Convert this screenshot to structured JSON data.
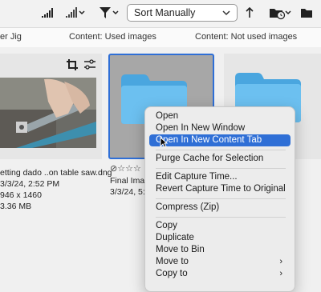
{
  "toolbar": {
    "sort_value": "Sort Manually"
  },
  "header": {
    "col1": "er Jig",
    "col2": "Content: Used images",
    "col3": "Content: Not used images"
  },
  "items": {
    "photo": {
      "filename": "etting dado ..on table saw.dng",
      "date": "3/3/24, 2:52 PM",
      "dimensions": "946 x 1460",
      "size": "3.36 MB"
    },
    "folder": {
      "name": "Final Image",
      "date": "3/3/24, 5:1"
    }
  },
  "context_menu": {
    "items": [
      {
        "label": "Open"
      },
      {
        "label": "Open In New Window"
      },
      {
        "label": "Open In New Content Tab"
      },
      {
        "label": "Purge Cache for Selection"
      },
      {
        "label": "Edit Capture Time..."
      },
      {
        "label": "Revert Capture Time to Original"
      },
      {
        "label": "Compress (Zip)"
      },
      {
        "label": "Copy"
      },
      {
        "label": "Duplicate"
      },
      {
        "label": "Move to Bin"
      },
      {
        "label": "Move to"
      },
      {
        "label": "Copy to"
      }
    ]
  },
  "colors": {
    "selection": "#2f6fd6",
    "folder": "#5fb7ee"
  }
}
